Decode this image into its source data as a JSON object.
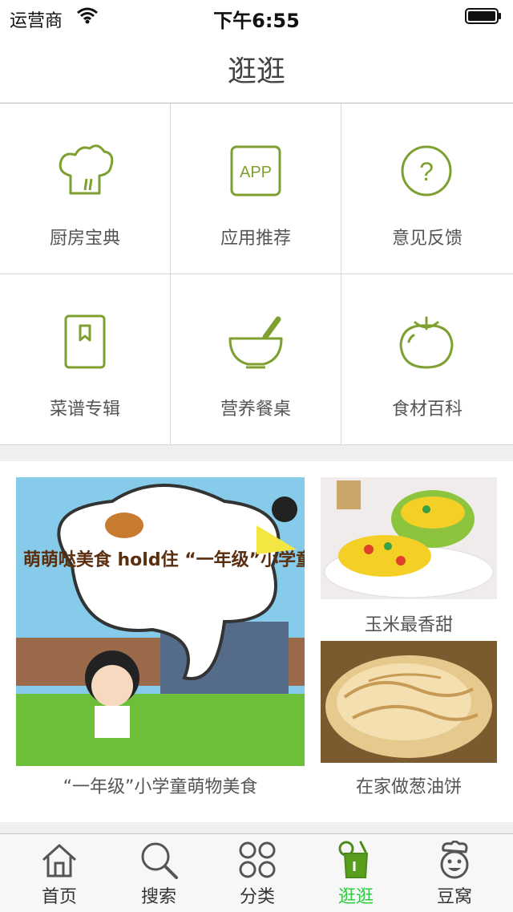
{
  "status_bar": {
    "carrier": "运营商",
    "time": "下午6:55"
  },
  "navbar": {
    "title": "逛逛"
  },
  "grid": [
    {
      "label": "厨房宝典",
      "icon": "chef-hat-icon"
    },
    {
      "label": "应用推荐",
      "icon": "app-icon",
      "icon_text": "APP"
    },
    {
      "label": "意见反馈",
      "icon": "question-icon",
      "icon_text": "?"
    },
    {
      "label": "菜谱专辑",
      "icon": "bookmark-book-icon"
    },
    {
      "label": "营养餐桌",
      "icon": "mortar-icon"
    },
    {
      "label": "食材百科",
      "icon": "tomato-icon"
    }
  ],
  "featured": {
    "main": {
      "caption": "“一年级”小学童萌物美食",
      "poster_text": "萌萌哒美食 hold住 “一年级”小学童"
    },
    "side": [
      {
        "caption": "玉米最香甜"
      },
      {
        "caption": "在家做葱油饼"
      }
    ]
  },
  "tabbar": {
    "active_color": "#2ecc40",
    "tabs": [
      {
        "label": "首页",
        "icon": "home-icon"
      },
      {
        "label": "搜索",
        "icon": "search-icon"
      },
      {
        "label": "分类",
        "icon": "category-icon"
      },
      {
        "label": "逛逛",
        "icon": "drink-icon",
        "active": true
      },
      {
        "label": "豆窝",
        "icon": "chef-face-icon"
      }
    ]
  },
  "colors": {
    "accent_icon": "#7da030",
    "tab_active": "#2ecc40"
  }
}
